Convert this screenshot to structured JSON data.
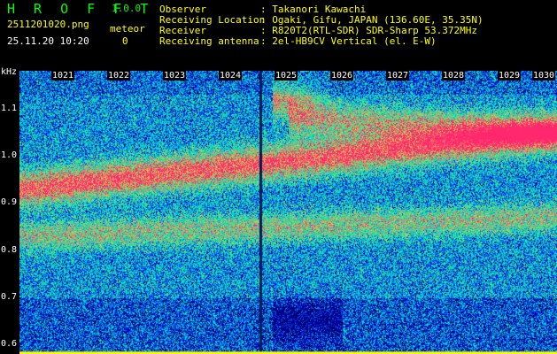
{
  "header": {
    "app_name": "H R O F F T",
    "version": "1.0.0",
    "filename": "2511201020.png",
    "mode_label": "meteor",
    "timestamp": "25.11.20 10:20",
    "count": "0",
    "fields": [
      {
        "label": "Observer",
        "value": ": Takanori Kawachi"
      },
      {
        "label": "Receiving Location",
        "value": ": Ogaki, Gifu, JAPAN (136.60E, 35.35N)"
      },
      {
        "label": "Receiver",
        "value": ": R820T2(RTL-SDR) SDR-Sharp 53.372MHz"
      },
      {
        "label": "Receiving antenna",
        "value": ": 2el-HB9CV Vertical (el. E-W)"
      }
    ]
  },
  "chart_data": {
    "type": "heatmap",
    "ylabel": "kHz",
    "yticks": [
      "1.1",
      "1.0",
      "0.9",
      "0.8",
      "0.7",
      "0.6"
    ],
    "ylim": [
      0.58,
      1.18
    ],
    "xticks": [
      "1021",
      "1022",
      "1023",
      "1024",
      "1025",
      "1026",
      "1027",
      "1028",
      "1029",
      "1030"
    ],
    "colors": {
      "low": "#0000cc",
      "mid": "#00cccc",
      "high": "#ff2266",
      "baseline": "#ffff00"
    }
  }
}
